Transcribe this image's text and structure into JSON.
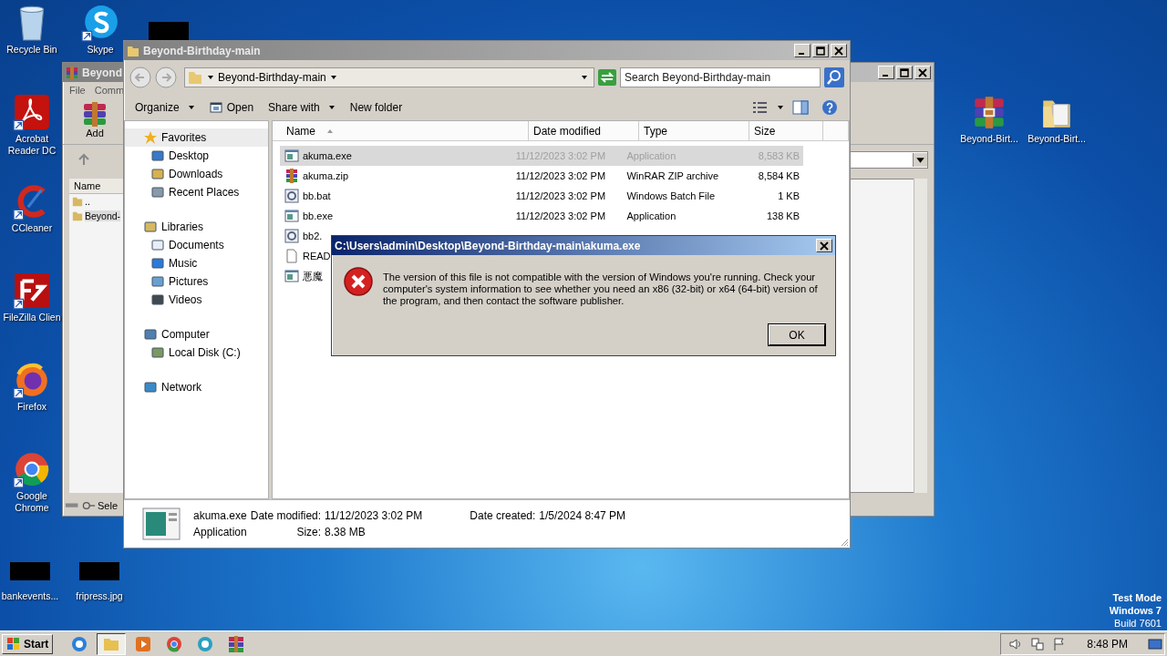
{
  "desktop_icons": [
    {
      "label": "Recycle Bin",
      "kind": "recycle",
      "shortcut": false
    },
    {
      "label": "Skype",
      "kind": "skype",
      "shortcut": true
    },
    {
      "label": "Acrobat Reader DC",
      "kind": "acrobat",
      "shortcut": true
    },
    {
      "label": "CCleaner",
      "kind": "ccleaner",
      "shortcut": true
    },
    {
      "label": "FileZilla Clien",
      "kind": "filezilla",
      "shortcut": true
    },
    {
      "label": "Firefox",
      "kind": "firefox",
      "shortcut": true
    },
    {
      "label": "Google Chrome",
      "kind": "chrome",
      "shortcut": true
    },
    {
      "label": "bankevents...",
      "kind": "redacted",
      "shortcut": false
    },
    {
      "label": "fripress.jpg",
      "kind": "redacted",
      "shortcut": false
    },
    {
      "label": "Beyond-Birt...",
      "kind": "winrar",
      "shortcut": false
    },
    {
      "label": "Beyond-Birt...",
      "kind": "folder",
      "shortcut": false
    },
    {
      "kind": "redacted",
      "shortcut": false
    }
  ],
  "back_window": {
    "title": "Beyond",
    "menu": [
      "File",
      "Comm"
    ],
    "toolbar": [
      "Add"
    ],
    "column": "Name",
    "items": [
      {
        "name": "..",
        "selected": false
      },
      {
        "name": "Beyond-",
        "selected": true
      }
    ],
    "status": "Sele"
  },
  "explorer": {
    "title": "Beyond-Birthday-main",
    "address": "Beyond-Birthday-main",
    "search": {
      "placeholder": "Search Beyond-Birthday-main"
    },
    "toolbar": [
      {
        "label": "Open",
        "kind": "open"
      }
    ],
    "toolbar_menus": [
      "Organize",
      "Share with"
    ],
    "new_folder": "New folder",
    "nav": [
      {
        "label": "Favorites",
        "kind": "star",
        "children": [
          {
            "label": "Desktop",
            "kind": "desktop"
          },
          {
            "label": "Downloads",
            "kind": "downloads"
          },
          {
            "label": "Recent Places",
            "kind": "recent"
          }
        ]
      },
      {
        "label": "Libraries",
        "kind": "library",
        "children": [
          {
            "label": "Documents",
            "kind": "documents"
          },
          {
            "label": "Music",
            "kind": "music"
          },
          {
            "label": "Pictures",
            "kind": "pictures"
          },
          {
            "label": "Videos",
            "kind": "videos"
          }
        ]
      },
      {
        "label": "Computer",
        "kind": "computer",
        "children": [
          {
            "label": "Local Disk (C:)",
            "kind": "disk"
          }
        ]
      },
      {
        "label": "Network",
        "kind": "network"
      }
    ],
    "columns": [
      "Name",
      "Date modified",
      "Type",
      "Size"
    ],
    "files": [
      {
        "name": "akuma.exe",
        "date": "11/12/2023 3:02 PM",
        "type": "Application",
        "size": "8,583 KB",
        "kind": "app",
        "selected": true
      },
      {
        "name": "akuma.zip",
        "date": "11/12/2023 3:02 PM",
        "type": "WinRAR ZIP archive",
        "size": "8,584 KB",
        "kind": "archive",
        "selected": false
      },
      {
        "name": "bb.bat",
        "date": "11/12/2023 3:02 PM",
        "type": "Windows Batch File",
        "size": "1 KB",
        "kind": "batch",
        "selected": false
      },
      {
        "name": "bb.exe",
        "date": "11/12/2023 3:02 PM",
        "type": "Application",
        "size": "138 KB",
        "kind": "setup",
        "selected": false
      },
      {
        "name": "bb2.",
        "kind": "batch",
        "selected": false
      },
      {
        "name": "READ",
        "kind": "text",
        "selected": false
      },
      {
        "name": "悪魔",
        "kind": "app",
        "selected": false
      }
    ],
    "details": {
      "name": "akuma.exe",
      "type": "Application",
      "fields": [
        {
          "label": "Date modified:",
          "value": "11/12/2023 3:02 PM"
        },
        {
          "label": "Size:",
          "value": "8.38 MB"
        },
        {
          "label": "Date created:",
          "value": "1/5/2024 8:47 PM"
        }
      ]
    }
  },
  "dialog": {
    "title": "C:\\Users\\admin\\Desktop\\Beyond-Birthday-main\\akuma.exe",
    "message": "The version of this file is not compatible with the version of Windows you're running. Check your computer's system information to see whether you need an x86 (32-bit) or x64 (64-bit) version of the program, and then contact the software publisher.",
    "button": "OK"
  },
  "os_notice": [
    "Test Mode",
    "Windows 7",
    "Build 7601"
  ],
  "taskbar": {
    "start": "Start",
    "apps": [
      {
        "kind": "ie",
        "selected": false
      },
      {
        "kind": "explorer",
        "selected": true
      },
      {
        "kind": "media",
        "selected": false
      },
      {
        "kind": "chrome",
        "selected": false
      },
      {
        "kind": "edge",
        "selected": false
      },
      {
        "kind": "winrar",
        "selected": false
      }
    ],
    "clock": "8:48 PM"
  }
}
